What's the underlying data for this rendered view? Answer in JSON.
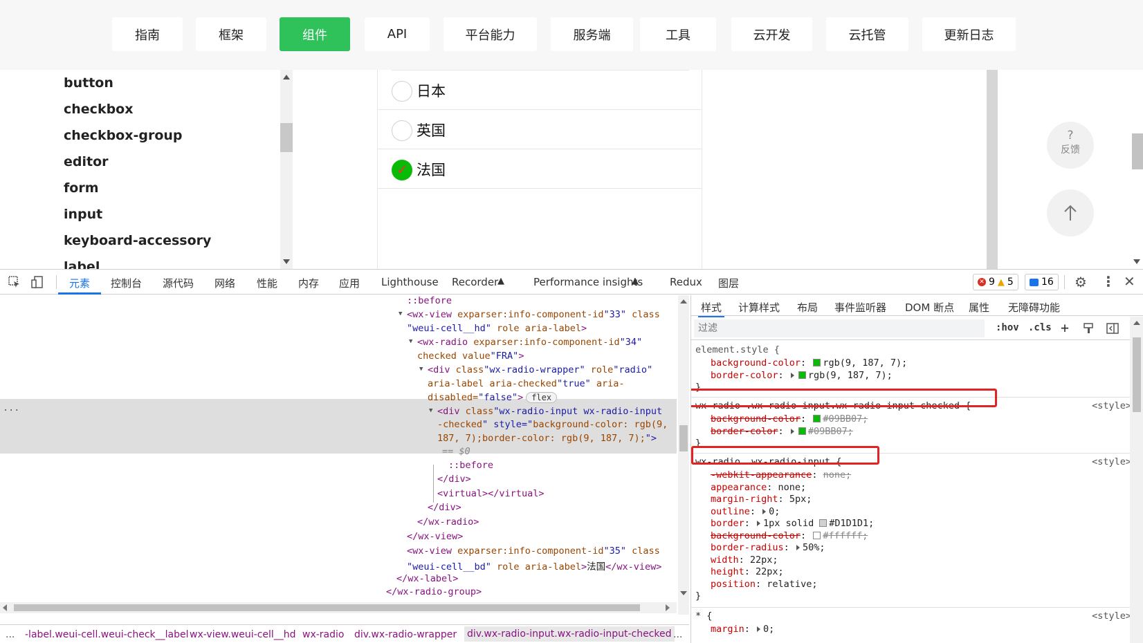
{
  "nav": {
    "ghost_text": "",
    "buttons": [
      {
        "label": "指南",
        "active": false
      },
      {
        "label": "框架",
        "active": false
      },
      {
        "label": "组件",
        "active": true
      },
      {
        "label": "API",
        "active": false
      },
      {
        "label": "平台能力",
        "active": false
      },
      {
        "label": "服务端",
        "active": false
      },
      {
        "label": "工具",
        "active": false
      },
      {
        "label": "云开发",
        "active": false
      },
      {
        "label": "云托管",
        "active": false
      },
      {
        "label": "更新日志",
        "active": false
      }
    ]
  },
  "sidebar": {
    "items": [
      "button",
      "checkbox",
      "checkbox-group",
      "editor",
      "form",
      "input",
      "keyboard-accessory",
      "label"
    ]
  },
  "radios": {
    "items": [
      {
        "label": "日本",
        "checked": false
      },
      {
        "label": "英国",
        "checked": false
      },
      {
        "label": "法国",
        "checked": true
      }
    ],
    "accent_color": "#09bb07"
  },
  "float": {
    "help_glyph": "?",
    "help_label": "反馈",
    "top_icon": "arrow-up-icon"
  },
  "devtools": {
    "tabs": [
      "元素",
      "控制台",
      "源代码",
      "网络",
      "性能",
      "内存",
      "应用",
      "Lighthouse",
      "Recorder",
      "Performance insights",
      "Redux",
      "图层"
    ],
    "active_tab": "元素",
    "errors": "9",
    "warnings": "5",
    "messages": "16",
    "elements": {
      "dots": "...",
      "dollar": "== $0",
      "flex_badge": "flex",
      "lines": [
        "::before",
        "<wx-view exparser:info-component-id=\"33\" class=",
        "\"weui-cell__hd\" role aria-label>",
        "<wx-radio exparser:info-component-id=\"34\"",
        "checked value=\"FRA\">",
        "<div class=\"wx-radio-wrapper\" role=\"radio\"",
        "aria-label aria-checked=\"true\" aria-",
        "disabled=\"false\">",
        "<div class=\"wx-radio-input wx-radio-input",
        "-checked\" style=\"background-color: rgb(9,",
        "187, 7);border-color: rgb(9, 187, 7);\">",
        "::before",
        "</div>",
        "<virtual></virtual>",
        "</div>",
        "</wx-radio>",
        "</wx-view>",
        "<wx-view exparser:info-component-id=\"35\" class=",
        "\"weui-cell__bd\" role aria-label>法国</wx-view>",
        "</wx-label>",
        "</wx-radio-group>"
      ]
    },
    "breadcrumbs": [
      "...",
      "-label.weui-cell.weui-check__label",
      "wx-view.weui-cell__hd",
      "wx-radio",
      "div.wx-radio-wrapper",
      "div.wx-radio-input.wx-radio-input-checked",
      "..."
    ],
    "styles": {
      "tabs": [
        "样式",
        "计算样式",
        "布局",
        "事件监听器",
        "DOM 断点",
        "属性",
        "无障碍功能"
      ],
      "active_tab": "样式",
      "filter_placeholder": "过滤",
      "hov": ":hov",
      "cls": ".cls",
      "plus": "+",
      "rules": [
        {
          "selector": "element.style {",
          "source": "",
          "decls": [
            {
              "prop": "background-color",
              "value": "rgb(9, 187, 7);",
              "swatch": "#09bb07",
              "strike": false,
              "arrow": false
            },
            {
              "prop": "border-color",
              "value": "rgb(9, 187, 7);",
              "swatch": "#09bb07",
              "strike": false,
              "arrow": true
            }
          ]
        },
        {
          "selector": "wx-radio .wx-radio-input.wx-radio-input-checked {",
          "source": "<style>",
          "decls": [
            {
              "prop": "background-color",
              "value": "#09BB07;",
              "swatch": "#09bb07",
              "strike": true,
              "arrow": false
            },
            {
              "prop": "border-color",
              "value": "#09BB07;",
              "swatch": "#09bb07",
              "strike": true,
              "arrow": true
            }
          ]
        },
        {
          "selector": "wx-radio .wx-radio-input {",
          "source": "<style>",
          "decls": [
            {
              "prop": "-webkit-appearance",
              "value": "none;",
              "swatch": "",
              "strike": true,
              "arrow": false
            },
            {
              "prop": "appearance",
              "value": "none;",
              "swatch": "",
              "strike": false,
              "arrow": false
            },
            {
              "prop": "margin-right",
              "value": "5px;",
              "swatch": "",
              "strike": false,
              "arrow": false
            },
            {
              "prop": "outline",
              "value": "0;",
              "swatch": "",
              "strike": false,
              "arrow": true
            },
            {
              "prop": "border",
              "value": "1px solid",
              "value2": "#D1D1D1;",
              "swatch": "#d1d1d1",
              "strike": false,
              "arrow": true
            },
            {
              "prop": "background-color",
              "value": "#ffffff;",
              "swatch": "#ffffff",
              "strike": true,
              "arrow": false
            },
            {
              "prop": "border-radius",
              "value": "50%;",
              "swatch": "",
              "strike": false,
              "arrow": true
            },
            {
              "prop": "width",
              "value": "22px;",
              "swatch": "",
              "strike": false,
              "arrow": false
            },
            {
              "prop": "height",
              "value": "22px;",
              "swatch": "",
              "strike": false,
              "arrow": false
            },
            {
              "prop": "position",
              "value": "relative;",
              "swatch": "",
              "strike": false,
              "arrow": false
            }
          ]
        },
        {
          "selector": "* {",
          "source": "<style>",
          "decls": [
            {
              "prop": "margin",
              "value": "0;",
              "swatch": "",
              "strike": false,
              "arrow": true
            }
          ]
        }
      ]
    }
  }
}
